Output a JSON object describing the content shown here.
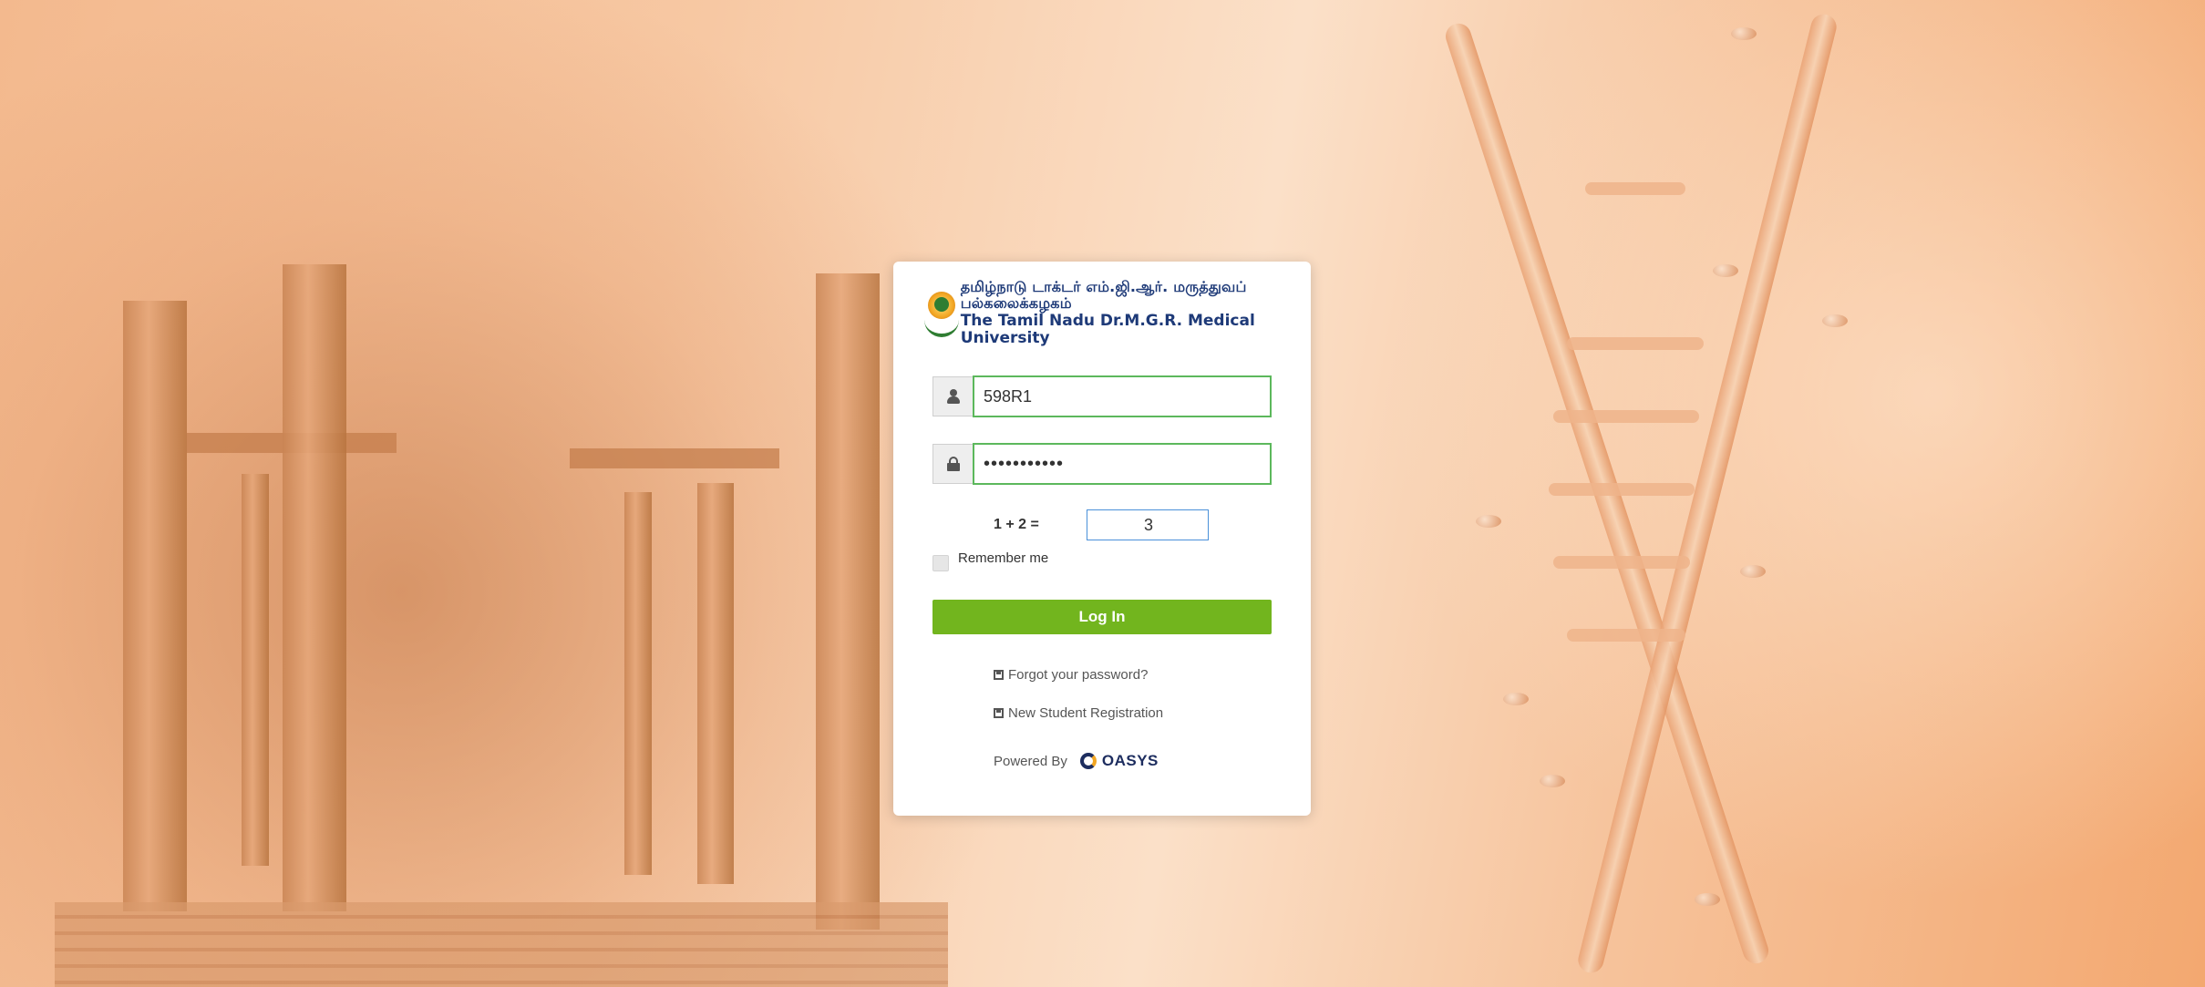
{
  "logo": {
    "tamil_name": "தமிழ்நாடு டாக்டர் எம்.ஜி.ஆர். மருத்துவப் பல்கலைக்கழகம்",
    "english_name": "The Tamil Nadu Dr.M.G.R. Medical University"
  },
  "form": {
    "username_value": "598R1",
    "password_value": "•••••••••••",
    "captcha_question": "1 + 2 =",
    "captcha_answer": "3",
    "remember_label": "Remember me",
    "remember_checked": false,
    "login_label": "Log In"
  },
  "links": {
    "forgot_password": "Forgot your password?",
    "new_registration": "New Student Registration"
  },
  "footer": {
    "powered_by": "Powered By",
    "vendor": "OASYS"
  },
  "colors": {
    "login_button": "#72b51e",
    "field_border_valid": "#5cb85c",
    "brand_navy": "#1e3a78"
  }
}
